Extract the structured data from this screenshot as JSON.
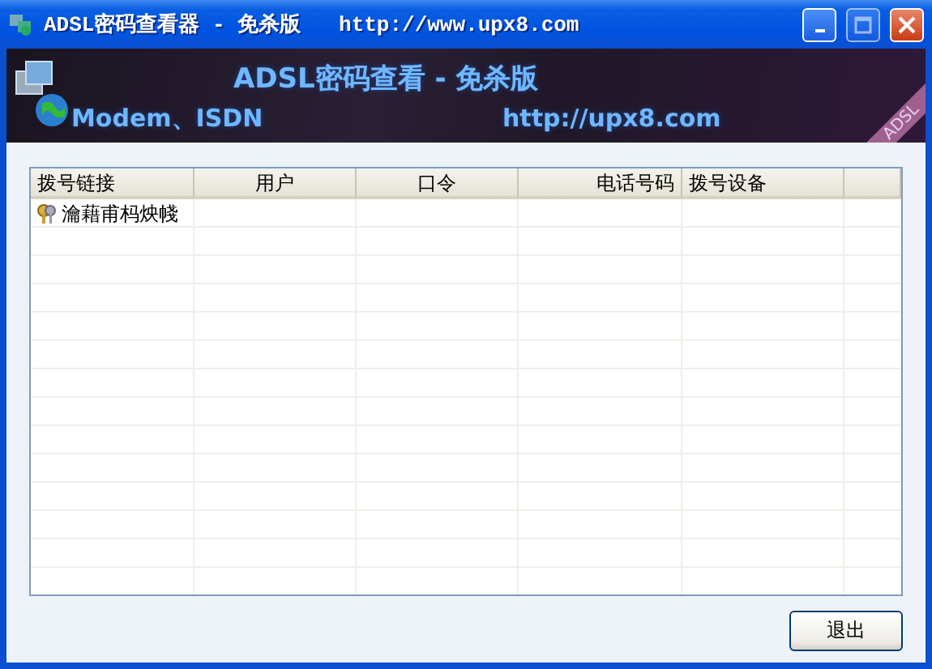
{
  "window": {
    "title": "ADSL密码查看器 - 免杀版   http://www.upx8.com"
  },
  "banner": {
    "heading": "ADSL密码查看 - 免杀版",
    "subtitle": "Modem、ISDN",
    "url": "http://upx8.com",
    "ribbon": "ADSL"
  },
  "table": {
    "columns": [
      "拨号链接",
      "用户",
      "口令",
      "电话号码",
      "拨号设备"
    ],
    "rows": [
      {
        "name": "瀹藉甫杩炴帴"
      }
    ]
  },
  "buttons": [
    "退出"
  ]
}
